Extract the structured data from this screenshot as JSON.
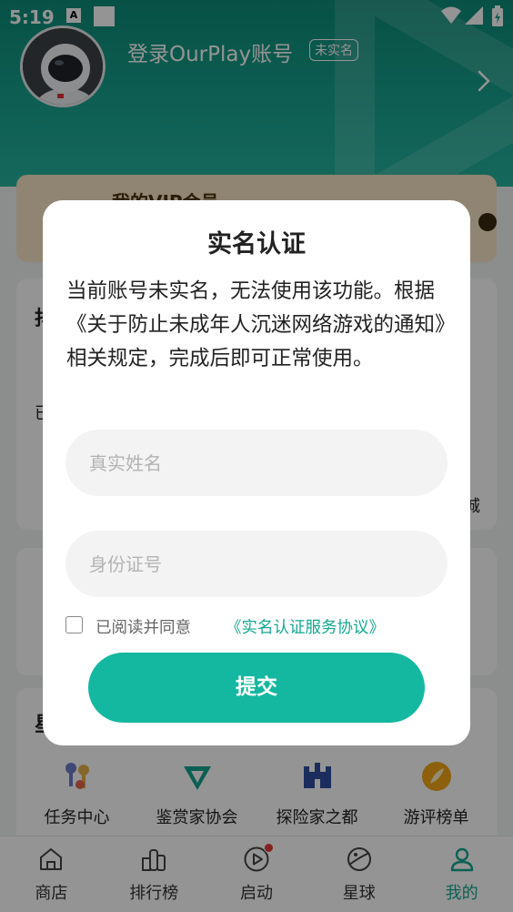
{
  "status_bar": {
    "time": "5:19",
    "notif_icon_letter": "A"
  },
  "header": {
    "login_text": "登录OurPlay账号",
    "badge": "未实名"
  },
  "vip_card": {
    "title": "我的VIP会员"
  },
  "peek": {
    "card_a_title_char": "抖",
    "card_a_line_char": "已",
    "card_a_right_char": "城",
    "card_c_title_char": "星"
  },
  "grid": [
    {
      "label": "任务中心",
      "icon": "task-key-icon"
    },
    {
      "label": "鉴赏家协会",
      "icon": "connoisseur-badge-icon"
    },
    {
      "label": "探险家之都",
      "icon": "castle-icon"
    },
    {
      "label": "游评榜单",
      "icon": "feather-icon"
    }
  ],
  "tabs": [
    {
      "label": "商店",
      "icon": "store-icon"
    },
    {
      "label": "排行榜",
      "icon": "ranking-icon"
    },
    {
      "label": "启动",
      "icon": "play-icon"
    },
    {
      "label": "星球",
      "icon": "planet-icon"
    },
    {
      "label": "我的",
      "icon": "profile-icon"
    }
  ],
  "dialog": {
    "title": "实名认证",
    "message": "当前账号未实名，无法使用该功能。根据《关于防止未成年人沉迷网络游戏的通知》相关规定，完成后即可正常使用。",
    "name_placeholder": "真实姓名",
    "id_placeholder": "身份证号",
    "name_value": "",
    "id_value": "",
    "agree_text": "已阅读并同意",
    "agree_link": "《实名认证服务协议》",
    "submit_label": "提交"
  },
  "colors": {
    "accent": "#14b8a0",
    "header": "#19a38f",
    "notification_dot": "#e53935"
  }
}
